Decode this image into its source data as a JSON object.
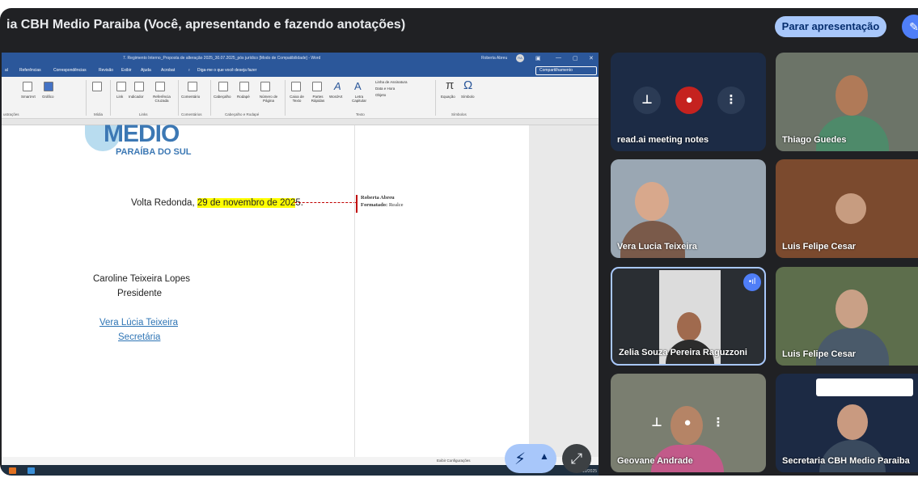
{
  "meeting": {
    "title": "ia CBH Medio Paraiba (Você, apresentando e fazendo anotações)",
    "stop_presenting_label": "Parar apresentação"
  },
  "word": {
    "doc_title": "7. Regimento Interno_Proposta de alteração 2025_30.07.2025_pós jurídico [Modo de Compatibilidade] - Word",
    "user_name": "Roberta Abreu",
    "user_initials": "RA",
    "menu": [
      "al",
      "Referências",
      "Correspondências",
      "Revisão",
      "Exibir",
      "Ajuda",
      "Acrobat",
      "Diga-me o que você deseja fazer"
    ],
    "share_label": "Compartilhamento",
    "ribbon_labels": [
      "SmartArt",
      "Gráfico",
      "Link",
      "Indicador",
      "Referência Cruzada",
      "Comentário",
      "Cabeçalho",
      "Rodapé",
      "Número de Página",
      "Caixa de Texto",
      "Partes Rápidas",
      "WordArt",
      "Letra Capitular",
      "Linha de Assinatura",
      "Data e Hora",
      "Objeto",
      "Equação",
      "Símbolo"
    ],
    "ribbon_groups": [
      "ustrações",
      "Mídia",
      "Links",
      "Comentários",
      "Cabeçalho e Rodapé",
      "Texto",
      "Símbolos"
    ],
    "status_text": "Exibir Configurações",
    "taskbar_date": "15/10/2025"
  },
  "document": {
    "logo_main": "MEDIO",
    "logo_sub": "PARAÍBA DO SUL",
    "date_prefix": "Volta Redonda, ",
    "date_highlight": "29 de novembro de 202",
    "date_suffix": "5.",
    "signer1_name": "Caroline Teixeira Lopes",
    "signer1_role": "Presidente",
    "signer2_name": "Vera Lúcia Teixeira",
    "signer2_role": "Secretária",
    "comment_author": "Roberta Abreu",
    "comment_label": "Formatado:",
    "comment_value": "Realce"
  },
  "participants": [
    {
      "name": "read.ai meeting notes"
    },
    {
      "name": "Thiago Guedes"
    },
    {
      "name": "Vera Lucia Teixeira"
    },
    {
      "name": "Luis Felipe Cesar"
    },
    {
      "name": "Zelia Souza Pereira Raguzzoni"
    },
    {
      "name": "Luis Felipe Cesar"
    },
    {
      "name": "Geovane Andrade"
    },
    {
      "name": "Secretaria CBH Medio Paraiba"
    }
  ],
  "colors": {
    "accent": "#a8c7fa",
    "word_blue": "#2b579a",
    "highlight": "#ffff00",
    "dark_bg": "#202124"
  }
}
